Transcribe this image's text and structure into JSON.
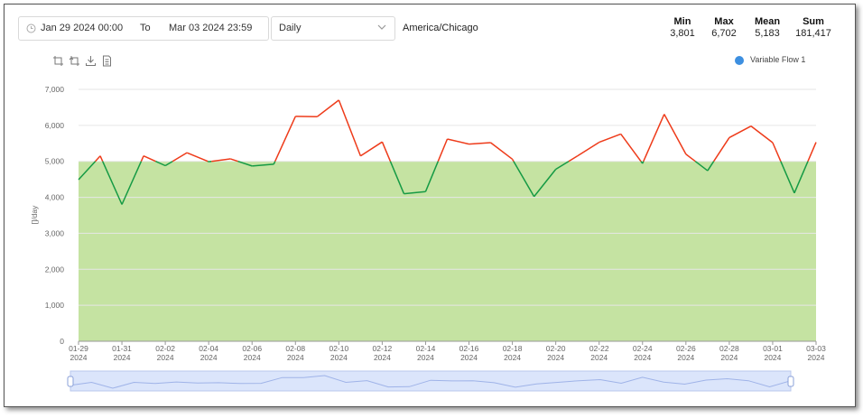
{
  "toolbar": {
    "date_start": "Jan 29 2024 00:00",
    "date_separator": "To",
    "date_end": "Mar 03 2024 23:59",
    "interval": "Daily",
    "timezone": "America/Chicago"
  },
  "stats": [
    {
      "label": "Min",
      "value": "3,801"
    },
    {
      "label": "Max",
      "value": "6,702"
    },
    {
      "label": "Mean",
      "value": "5,183"
    },
    {
      "label": "Sum",
      "value": "181,417"
    }
  ],
  "tool_icons": [
    "zoom-area-icon",
    "zoom-reset-icon",
    "download-icon",
    "data-view-icon"
  ],
  "chart_data": {
    "type": "line",
    "ylabel": "[]/day",
    "ylim": [
      0,
      7000
    ],
    "yticks": [
      "0",
      "1,000",
      "2,000",
      "3,000",
      "4,000",
      "5,000",
      "6,000",
      "7,000"
    ],
    "threshold": 5000,
    "grid": true,
    "legend_position": "top-right",
    "xtick_labels": [
      [
        "01-29",
        "2024"
      ],
      [
        "01-31",
        "2024"
      ],
      [
        "02-02",
        "2024"
      ],
      [
        "02-04",
        "2024"
      ],
      [
        "02-06",
        "2024"
      ],
      [
        "02-08",
        "2024"
      ],
      [
        "02-10",
        "2024"
      ],
      [
        "02-12",
        "2024"
      ],
      [
        "02-14",
        "2024"
      ],
      [
        "02-16",
        "2024"
      ],
      [
        "02-18",
        "2024"
      ],
      [
        "02-20",
        "2024"
      ],
      [
        "02-22",
        "2024"
      ],
      [
        "02-24",
        "2024"
      ],
      [
        "02-26",
        "2024"
      ],
      [
        "02-28",
        "2024"
      ],
      [
        "03-01",
        "2024"
      ],
      [
        "03-03",
        "2024"
      ]
    ],
    "x": [
      "2024-01-29",
      "2024-01-30",
      "2024-01-31",
      "2024-02-01",
      "2024-02-02",
      "2024-02-03",
      "2024-02-04",
      "2024-02-05",
      "2024-02-06",
      "2024-02-07",
      "2024-02-08",
      "2024-02-09",
      "2024-02-10",
      "2024-02-11",
      "2024-02-12",
      "2024-02-13",
      "2024-02-14",
      "2024-02-15",
      "2024-02-16",
      "2024-02-17",
      "2024-02-18",
      "2024-02-19",
      "2024-02-20",
      "2024-02-21",
      "2024-02-22",
      "2024-02-23",
      "2024-02-24",
      "2024-02-25",
      "2024-02-26",
      "2024-02-27",
      "2024-02-28",
      "2024-02-29",
      "2024-03-01",
      "2024-03-02",
      "2024-03-03"
    ],
    "series": [
      {
        "name": "Variable Flow 1",
        "values": [
          4490,
          5150,
          3801,
          5150,
          4880,
          5240,
          4990,
          5070,
          4870,
          4920,
          6250,
          6240,
          6702,
          5150,
          5540,
          4100,
          4160,
          5620,
          5480,
          5520,
          5060,
          4020,
          4780,
          5150,
          5530,
          5760,
          4940,
          6310,
          5200,
          4740,
          5660,
          5980,
          5520,
          4120,
          5530
        ]
      }
    ],
    "colors": {
      "above": "#ee3b1a",
      "below": "#159a44",
      "band_fill": "#c5e3a2",
      "legend_dot": "#3d8fe0",
      "slider_fill": "#dbe5fb"
    }
  }
}
